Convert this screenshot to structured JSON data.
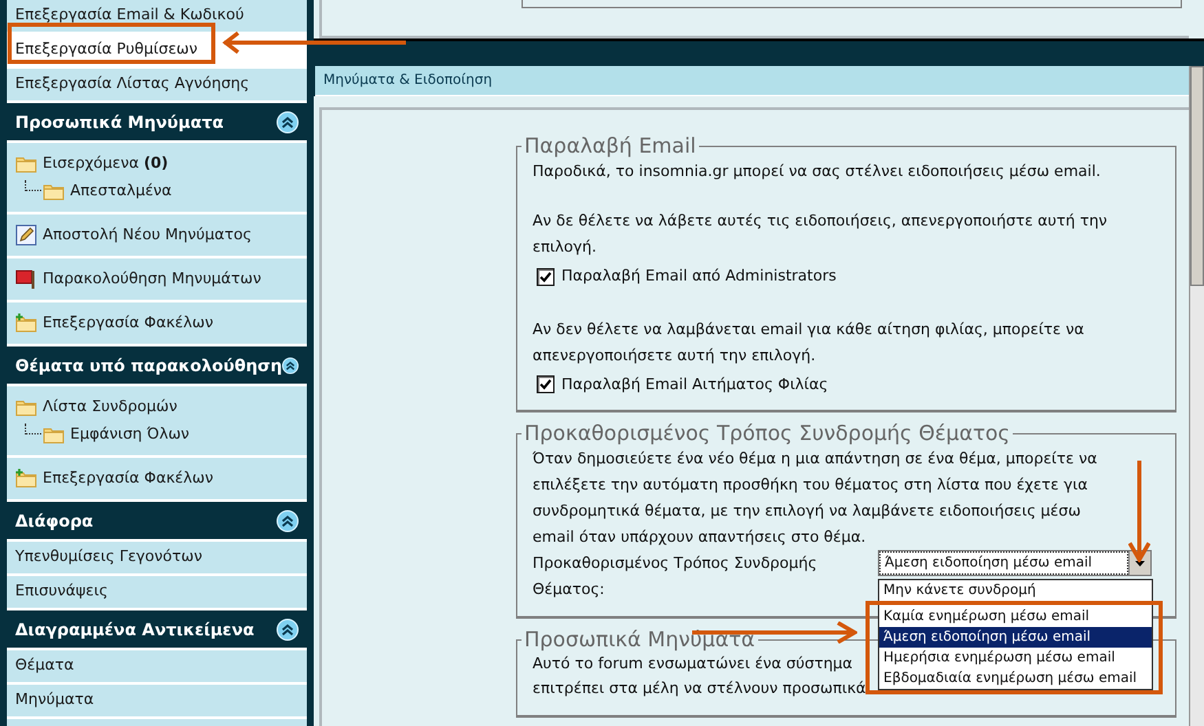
{
  "sidebar": {
    "groups": [
      {
        "items": [
          {
            "kind": "link",
            "label": "Επεξεργασία Email & Κωδικού",
            "selected": false
          },
          {
            "kind": "link",
            "label": "Επεξεργασία Ρυθμίσεων",
            "selected": true
          },
          {
            "kind": "link",
            "label": "Επεξεργασία Λίστας Αγνόησης",
            "selected": false
          }
        ]
      },
      {
        "title": "Προσωπικά Μηνύματα",
        "expanded": true,
        "items": [
          {
            "kind": "tree",
            "folders": [
              {
                "label": "Εισερχόμενα **(0)**",
                "children": [
                  {
                    "label": "Απεσταλμένα"
                  }
                ]
              }
            ]
          },
          {
            "kind": "compose",
            "label": "Αποστολή Νέου Μηνύματος",
            "selected": false
          },
          {
            "kind": "flag",
            "label": "Παρακολούθηση Μηνυμάτων",
            "selected": false
          },
          {
            "kind": "add-folder",
            "label": "Επεξεργασία Φακέλων",
            "selected": false
          }
        ]
      },
      {
        "title": "Θέματα υπό παρακολούθηση",
        "expanded": true,
        "items": [
          {
            "kind": "tree",
            "folders": [
              {
                "label": "Λίστα Συνδρομών",
                "children": [
                  {
                    "label": "Εμφάνιση Όλων"
                  }
                ]
              }
            ]
          },
          {
            "kind": "add-folder",
            "label": "Επεξεργασία Φακέλων",
            "selected": false
          }
        ]
      },
      {
        "title": "Διάφορα",
        "expanded": true,
        "items": [
          {
            "kind": "link",
            "label": "Υπενθυμίσεις Γεγονότων",
            "selected": false
          },
          {
            "kind": "link",
            "label": "Επισυνάψεις",
            "selected": false
          }
        ]
      },
      {
        "title": "Διαγραμμένα Αντικείμενα",
        "expanded": true,
        "items": [
          {
            "kind": "link",
            "label": "Θέματα",
            "selected": false
          },
          {
            "kind": "link",
            "label": "Μηνύματα",
            "selected": false
          }
        ]
      }
    ]
  },
  "panel": {
    "title": "Μηνύματα & Ειδοποίηση",
    "fieldsets": [
      {
        "legend": "Παραλαβή Email",
        "blocks": [
          {
            "kind": "text",
            "text": "Παροδικά, το insomnia.gr μπορεί να σας στέλνει ειδοποιήσεις μέσω email."
          },
          {
            "kind": "text",
            "text": "Αν δε θέλετε να λάβετε αυτές τις ειδοποιήσεις, απενεργοποιήστε αυτή την επιλογή."
          },
          {
            "kind": "checkbox",
            "label": "Παραλαβή Email από Administrators",
            "checked": true
          },
          {
            "kind": "text",
            "text": "Αν δεν θέλετε να λαμβάνεται email για κάθε αίτηση φιλίας, μπορείτε να απενεργοποιήσετε αυτή την επιλογή."
          },
          {
            "kind": "checkbox",
            "label": "Παραλαβή Email Αιτήματος Φιλίας",
            "checked": true
          }
        ]
      },
      {
        "legend": "Προκαθορισμένος Τρόπος Συνδρομής Θέματος",
        "blocks": [
          {
            "kind": "text",
            "text": "Όταν δημοσιεύετε ένα νέο θέμα η μια απάντηση σε ένα θέμα, μπορείτε να επιλέξετε την αυτόματη προσθήκη του θέματος στη λίστα που έχετε για συνδρομητικά θέματα, με την επιλογή να λαμβάνετε ειδοποιήσεις μέσω email όταν υπάρχουν απαντήσεις στο θέμα."
          },
          {
            "kind": "select",
            "label": "Προκαθορισμένος Τρόπος Συνδρομής Θέματος:",
            "value": "Άμεση ειδοποίηση μέσω email",
            "open": true,
            "options": [
              {
                "label": "Μην κάνετε συνδρομή",
                "selected": false
              },
              {
                "label": "Καμία ενημέρωση μέσω email",
                "selected": false
              },
              {
                "label": "Άμεση ειδοποίηση μέσω email",
                "selected": true
              },
              {
                "label": "Ημερήσια ενημέρωση μέσω email",
                "selected": false
              },
              {
                "label": "Εβδομαδιαία ενημέρωση μέσω email",
                "selected": false
              }
            ]
          }
        ]
      },
      {
        "legend": "Προσωπικά Μηνύματα",
        "blocks": [
          {
            "kind": "line",
            "text": "Αυτό το forum ενσωματώνει ένα σύστημα"
          },
          {
            "kind": "line",
            "text": "επιτρέπει στα μέλη να στέλνουν προσωπικά"
          }
        ]
      }
    ]
  }
}
